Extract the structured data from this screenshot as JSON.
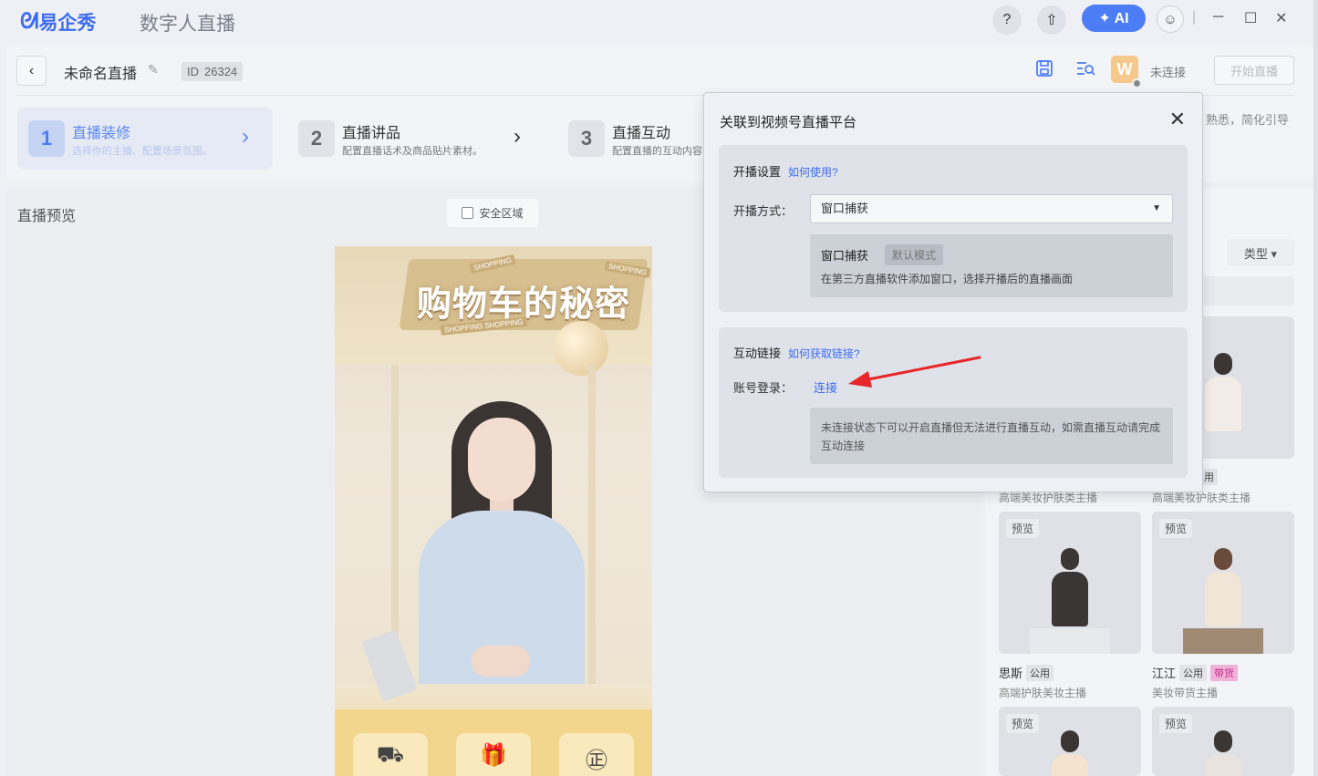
{
  "titlebar": {
    "logo_mark": "ᘛ",
    "logo_text": "易企秀",
    "app_name": "数字人直播",
    "help_label": "?",
    "upload_label": "⇧",
    "ai_label": "✦ AI",
    "avatar_glyph": "☺",
    "separator": "|",
    "minimize": "─",
    "maximize": "☐",
    "close": "✕"
  },
  "header": {
    "back": "‹",
    "title": "未命名直播",
    "edit_glyph": "✎",
    "id_label": "ID",
    "id_value": "26324",
    "save_glyph": "💾",
    "preview_glyph": "⧉",
    "mini_app_glyph": "W",
    "connection_status": "未连接",
    "start_button": "开始直播"
  },
  "steps": [
    {
      "num": "1",
      "title": "直播装修",
      "subtitle": "选择你的主播、配置场景氛围。"
    },
    {
      "num": "2",
      "title": "直播讲品",
      "subtitle": "配置直播话术及商品贴片素材。"
    },
    {
      "num": "3",
      "title": "直播互动",
      "subtitle": "配置直播的互动内容"
    }
  ],
  "step_arrow": "›",
  "right_desc": "熟悉，简化引导",
  "preview": {
    "label": "直播预览",
    "safe_zone": "安全区域",
    "banner_title": "购物车的秘密",
    "tag_shopping": "SHOPPING",
    "tag_shopping_shopping": "SHOPPING SHOPPING",
    "feature_icons": [
      "⛟",
      "🎁",
      "㊣"
    ]
  },
  "right_panel": {
    "type_filter": "类型 ▾",
    "preview_label": "预览",
    "cards": [
      {
        "name": "",
        "desc": "高端美妆护肤类主播"
      },
      {
        "name": "",
        "desc": "高端美妆护肤类主播"
      },
      {
        "name": "思斯",
        "badge": "公用",
        "desc": "高端护肤美妆主播"
      },
      {
        "name": "江江",
        "badge": "公用",
        "badge2": "带货",
        "desc": "美妆带货主播"
      }
    ],
    "partial_badge": "用"
  },
  "modal": {
    "title": "关联到视频号直播平台",
    "close": "✕",
    "section1": {
      "title": "开播设置",
      "help_link": "如何使用?",
      "method_label": "开播方式：",
      "method_value": "窗口捕获",
      "caret": "▼",
      "mode_name": "窗口捕获",
      "mode_tag": "默认模式",
      "mode_desc": "在第三方直播软件添加窗口，选择开播后的直播画面"
    },
    "section2": {
      "title": "互动链接",
      "help_link": "如何获取链接?",
      "login_label": "账号登录：",
      "connect": "连接",
      "note": "未连接状态下可以开启直播但无法进行直播互动，如需直播互动请完成互动连接"
    }
  },
  "colors": {
    "accent": "#3d6cf0",
    "annotation_arrow": "#e8262a"
  }
}
